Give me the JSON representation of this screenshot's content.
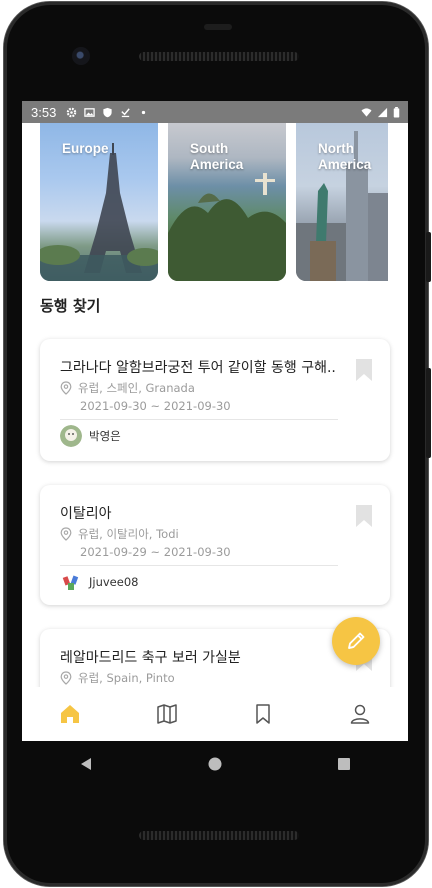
{
  "status_bar": {
    "time": "3:53"
  },
  "destinations": [
    {
      "name": "Europe"
    },
    {
      "name": "South America"
    },
    {
      "name": "North America"
    }
  ],
  "section_title": "동행 찾기",
  "posts": [
    {
      "title": "그라나다 알함브라궁전 투어 같이할 동행 구해..",
      "location": "유럽, 스페인, Granada",
      "dates": "2021-09-30 ~ 2021-09-30",
      "user": "박영은"
    },
    {
      "title": "이탈리아",
      "location": "유럽, 이탈리아, Todi",
      "dates": "2021-09-29 ~ 2021-09-30",
      "user": "Jjuvee08"
    },
    {
      "title": "레알마드리드 축구 보러 가실분",
      "location": "유럽, Spain, Pinto"
    }
  ],
  "bottom_nav": [
    {
      "icon": "home-icon",
      "active": true
    },
    {
      "icon": "map-icon",
      "active": false
    },
    {
      "icon": "bookmark-icon",
      "active": false
    },
    {
      "icon": "profile-icon",
      "active": false
    }
  ],
  "colors": {
    "accent": "#f6c544",
    "status_bar": "#7b7b7b",
    "muted_text": "#9b9b9b",
    "nav_inactive": "#555555"
  }
}
